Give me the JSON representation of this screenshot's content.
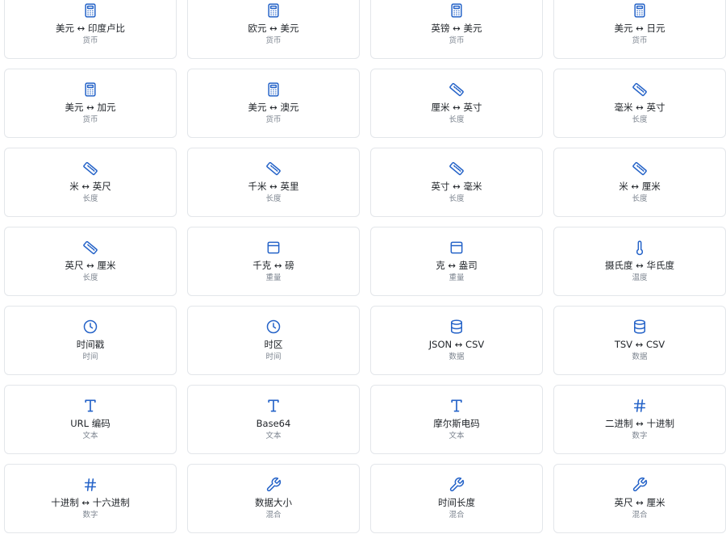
{
  "cards": [
    {
      "title": "美元 ↔ 印度卢比",
      "category": "货币",
      "icon": "calculator-icon"
    },
    {
      "title": "欧元 ↔ 美元",
      "category": "货币",
      "icon": "calculator-icon"
    },
    {
      "title": "英镑 ↔ 美元",
      "category": "货币",
      "icon": "calculator-icon"
    },
    {
      "title": "美元 ↔ 日元",
      "category": "货币",
      "icon": "calculator-icon"
    },
    {
      "title": "美元 ↔ 加元",
      "category": "货币",
      "icon": "calculator-icon"
    },
    {
      "title": "美元 ↔ 澳元",
      "category": "货币",
      "icon": "calculator-icon"
    },
    {
      "title": "厘米 ↔ 英寸",
      "category": "长度",
      "icon": "ruler-icon"
    },
    {
      "title": "毫米 ↔ 英寸",
      "category": "长度",
      "icon": "ruler-icon"
    },
    {
      "title": "米 ↔ 英尺",
      "category": "长度",
      "icon": "ruler-icon"
    },
    {
      "title": "千米 ↔ 英里",
      "category": "长度",
      "icon": "ruler-icon"
    },
    {
      "title": "英寸 ↔ 毫米",
      "category": "长度",
      "icon": "ruler-icon"
    },
    {
      "title": "米 ↔ 厘米",
      "category": "长度",
      "icon": "ruler-icon"
    },
    {
      "title": "英尺 ↔ 厘米",
      "category": "长度",
      "icon": "ruler-icon"
    },
    {
      "title": "千克 ↔ 磅",
      "category": "重量",
      "icon": "scale-icon"
    },
    {
      "title": "克 ↔ 盎司",
      "category": "重量",
      "icon": "scale-icon"
    },
    {
      "title": "摄氏度 ↔ 华氏度",
      "category": "温度",
      "icon": "thermometer-icon"
    },
    {
      "title": "时间戳",
      "category": "时间",
      "icon": "clock-icon"
    },
    {
      "title": "时区",
      "category": "时间",
      "icon": "clock-icon"
    },
    {
      "title": "JSON ↔ CSV",
      "category": "数据",
      "icon": "database-icon"
    },
    {
      "title": "TSV ↔ CSV",
      "category": "数据",
      "icon": "database-icon"
    },
    {
      "title": "URL 编码",
      "category": "文本",
      "icon": "text-icon"
    },
    {
      "title": "Base64",
      "category": "文本",
      "icon": "text-icon"
    },
    {
      "title": "摩尔斯电码",
      "category": "文本",
      "icon": "text-icon"
    },
    {
      "title": "二进制 ↔ 十进制",
      "category": "数字",
      "icon": "hash-icon"
    },
    {
      "title": "十进制 ↔ 十六进制",
      "category": "数字",
      "icon": "hash-icon"
    },
    {
      "title": "数据大小",
      "category": "混合",
      "icon": "wrench-icon"
    },
    {
      "title": "时间长度",
      "category": "混合",
      "icon": "wrench-icon"
    },
    {
      "title": "英尺 ↔ 厘米",
      "category": "混合",
      "icon": "wrench-icon"
    }
  ],
  "colors": {
    "accent": "#2563c8",
    "border": "#e3e6ea",
    "title": "#1f2328",
    "subtitle": "#7d8590"
  }
}
